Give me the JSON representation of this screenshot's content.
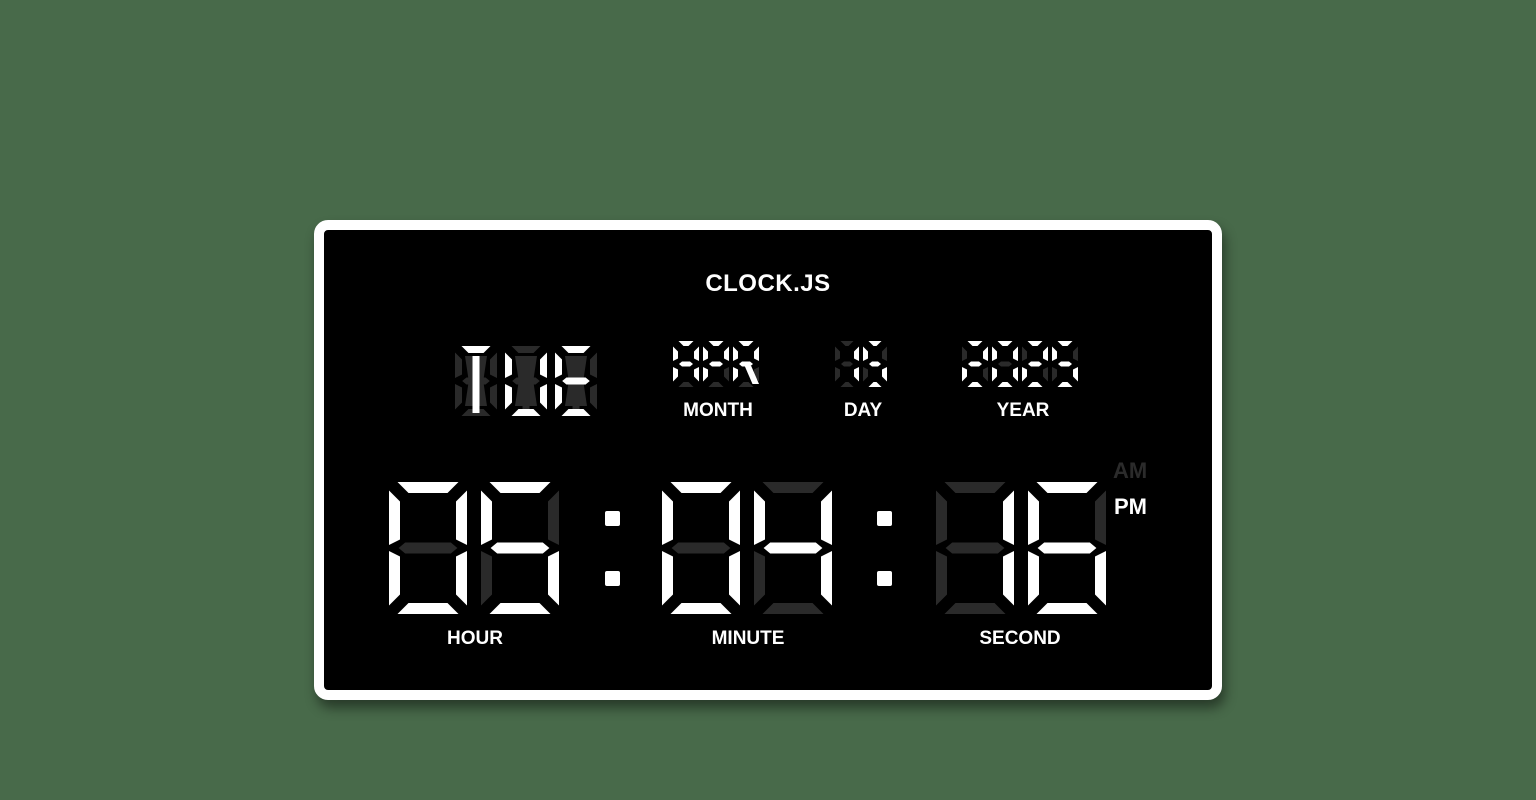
{
  "app": {
    "title": "CLOCK.JS"
  },
  "date": {
    "weekday": "TUE",
    "month": "APR",
    "day": "15",
    "year": "2025",
    "labels": {
      "month": "MONTH",
      "day": "DAY",
      "year": "YEAR"
    }
  },
  "time": {
    "hour": "05",
    "minute": "04",
    "second": "16",
    "labels": {
      "hour": "HOUR",
      "minute": "MINUTE",
      "second": "SECOND"
    }
  },
  "meridiem": {
    "am": "AM",
    "pm": "PM",
    "active": "PM"
  },
  "colors": {
    "lit": "#ffffff",
    "unlit": "#2a2a2a",
    "background": "#486a4a",
    "panel": "#000000",
    "am_inactive": "#2b2b2b"
  }
}
